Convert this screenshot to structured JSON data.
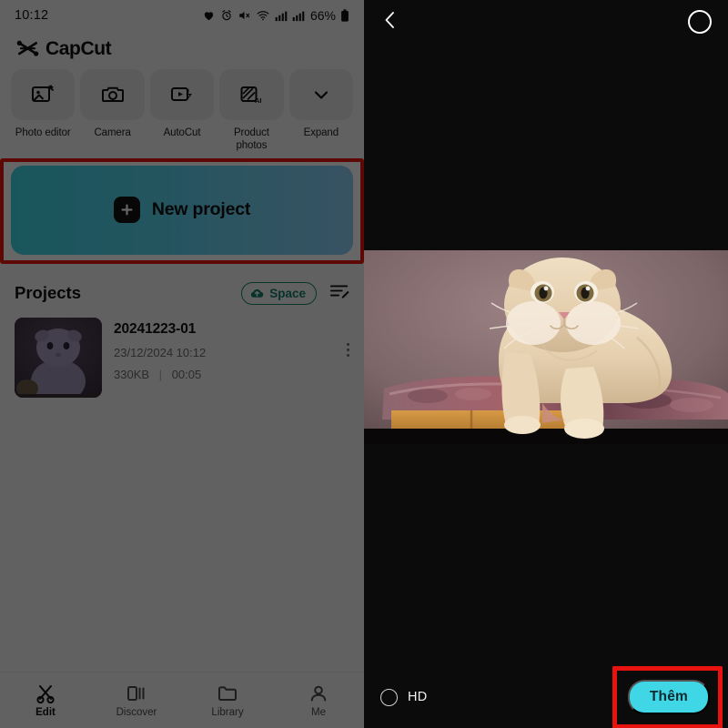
{
  "left_app": {
    "status_bar": {
      "time": "10:12",
      "battery_percent": "66%",
      "icons": [
        "heart-icon",
        "alarm-icon",
        "mute-icon",
        "wifi-icon",
        "signal-bars-icon",
        "signal-bars-2-icon",
        "battery-icon"
      ]
    },
    "brand": {
      "name": "CapCut",
      "logo": "capcut-logo-icon"
    },
    "tools": [
      {
        "label": "Photo editor",
        "icon": "photo-editor-icon"
      },
      {
        "label": "Camera",
        "icon": "camera-icon"
      },
      {
        "label": "AutoCut",
        "icon": "autocut-icon"
      },
      {
        "label": "Product photos",
        "icon": "product-photos-ai-icon"
      },
      {
        "label": "Expand",
        "icon": "chevron-down-icon"
      }
    ],
    "new_project": {
      "label": "New project",
      "icon": "plus-icon",
      "gradient_from": "#3fd6e6",
      "gradient_to": "#8ecdf5",
      "highlight_color": "#e8120f"
    },
    "projects": {
      "title": "Projects",
      "space_button": {
        "label": "Space",
        "icon": "cloud-upload-icon",
        "color": "#12806a"
      },
      "sort_icon": "sort-edit-icon",
      "items": [
        {
          "name": "20241223-01",
          "datetime": "23/12/2024 10:12",
          "size": "330KB",
          "separator": "|",
          "duration": "00:05",
          "menu_icon": "kebab-menu-icon",
          "thumbnail": "cat-thumbnail"
        }
      ]
    },
    "bottom_nav": [
      {
        "label": "Edit",
        "icon": "scissors-icon",
        "active": true
      },
      {
        "label": "Discover",
        "icon": "discover-icon",
        "active": false
      },
      {
        "label": "Library",
        "icon": "folder-icon",
        "active": false
      },
      {
        "label": "Me",
        "icon": "person-icon",
        "active": false
      }
    ]
  },
  "right_app": {
    "top_bar": {
      "back_icon": "chevron-left-icon",
      "select_circle": "select-circle-icon"
    },
    "preview": {
      "media": "scottish-fold-cat-photo"
    },
    "bottom_bar": {
      "hd_label": "HD",
      "hd_radio": "radio-unchecked-icon",
      "confirm_label": "Thêm",
      "confirm_color": "#3fd6e6",
      "highlight_color": "#e8120f"
    }
  }
}
